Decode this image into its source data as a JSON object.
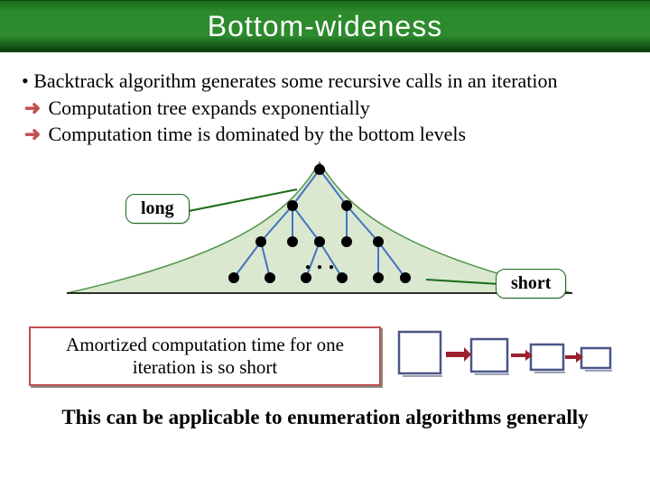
{
  "title": "Bottom-wideness",
  "bullet1": "Backtrack algorithm generates some recursive calls in an iteration",
  "sub1": " Computation tree expands exponentially",
  "sub2": " Computation time is dominated by the bottom levels",
  "callout_long": "long",
  "callout_short": "short",
  "dots": ". . .",
  "amortized": "Amortized computation time for one iteration is so short",
  "bottom": "This can be applicable to enumeration algorithms generally"
}
